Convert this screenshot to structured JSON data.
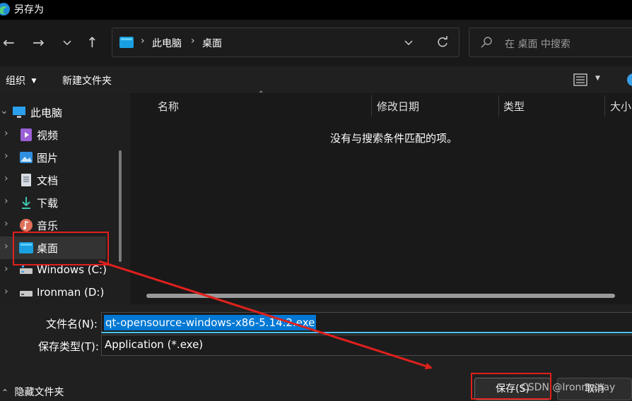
{
  "window": {
    "title": "另存为"
  },
  "address": {
    "segments": [
      "此电脑",
      "桌面"
    ]
  },
  "search": {
    "placeholder": "在 桌面 中搜索"
  },
  "toolbar": {
    "organize": "组织",
    "new_folder": "新建文件夹"
  },
  "sidebar": {
    "items": [
      {
        "label": "此电脑",
        "icon": "pc-icon"
      },
      {
        "label": "视频",
        "icon": "video-icon"
      },
      {
        "label": "图片",
        "icon": "picture-icon"
      },
      {
        "label": "文档",
        "icon": "document-icon"
      },
      {
        "label": "下载",
        "icon": "download-icon"
      },
      {
        "label": "音乐",
        "icon": "music-icon"
      },
      {
        "label": "桌面",
        "icon": "desktop-icon",
        "selected": true
      },
      {
        "label": "Windows (C:)",
        "icon": "drive-icon"
      },
      {
        "label": "Ironman (D:)",
        "icon": "drive-icon"
      }
    ]
  },
  "columns": {
    "name": "名称",
    "modified": "修改日期",
    "type": "类型",
    "size": "大小"
  },
  "empty_message": "没有与搜索条件匹配的项。",
  "form": {
    "filename_label": "文件名(N):",
    "filename_value": "qt-opensource-windows-x86-5.14.2.exe",
    "filetype_label": "保存类型(T):",
    "filetype_value": "Application (*.exe)"
  },
  "footer": {
    "hide_folders": "隐藏文件夹",
    "save": "保存(S)",
    "cancel": "取消"
  },
  "watermark": "CSDN @Ironmanay",
  "colors": {
    "accent": "#0078d4",
    "annotation": "#e0201c",
    "background": "#202020"
  }
}
